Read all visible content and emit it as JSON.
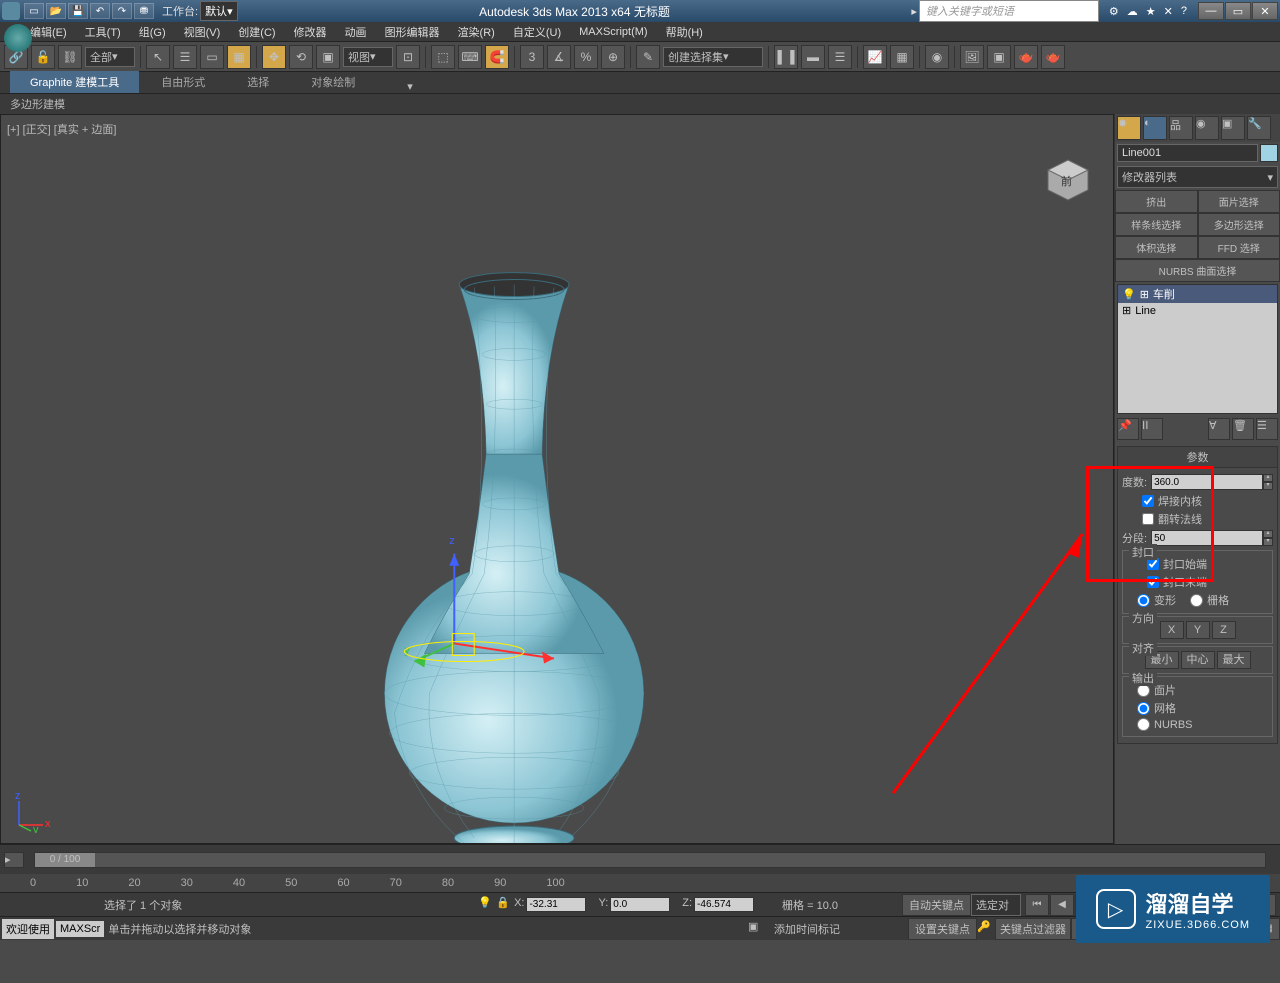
{
  "titlebar": {
    "workspace_label": "工作台: ",
    "workspace_value": "默认",
    "app_title": "Autodesk 3ds Max  2013 x64   无标题",
    "search_placeholder": "键入关键字或短语"
  },
  "menu": {
    "items": [
      "编辑(E)",
      "工具(T)",
      "组(G)",
      "视图(V)",
      "创建(C)",
      "修改器",
      "动画",
      "图形编辑器",
      "渲染(R)",
      "自定义(U)",
      "MAXScript(M)",
      "帮助(H)"
    ]
  },
  "toolbar": {
    "filter_all": "全部",
    "view_dropdown": "视图",
    "set_dropdown": "创建选择集"
  },
  "ribbon": {
    "tabs": [
      "Graphite 建模工具",
      "自由形式",
      "选择",
      "对象绘制"
    ],
    "subheader": "多边形建模"
  },
  "viewport": {
    "label": "[+] [正交] [真实 + 边面]"
  },
  "panel": {
    "object_name": "Line001",
    "modifier_list": "修改器列表",
    "mod_buttons": [
      "挤出",
      "面片选择",
      "样条线选择",
      "多边形选择",
      "体积选择",
      "FFD 选择",
      "NURBS 曲面选择"
    ],
    "stack_items": [
      "车削",
      "Line"
    ],
    "rollout_params": "参数",
    "degrees_label": "度数:",
    "degrees_value": "360.0",
    "weld_core": "焊接内核",
    "flip_normals": "翻转法线",
    "segments_label": "分段:",
    "segments_value": "50",
    "cap_label": "封口",
    "cap_start": "封口始端",
    "cap_end": "封口末端",
    "morph": "变形",
    "grid": "栅格",
    "direction": "方向",
    "dir_x": "X",
    "dir_y": "Y",
    "dir_z": "Z",
    "align": "对齐",
    "align_min": "最小",
    "align_center": "中心",
    "align_max": "最大",
    "output": "输出",
    "out_patch": "面片",
    "out_mesh": "网格",
    "out_nurbs": "NURBS"
  },
  "timeline": {
    "slider_text": "0 / 100",
    "marks": [
      "0",
      "10",
      "20",
      "30",
      "40",
      "50",
      "60",
      "70",
      "80",
      "90",
      "100"
    ]
  },
  "status": {
    "selection": "选择了 1 个对象",
    "welcome": "欢迎使用",
    "maxscript": "MAXScr",
    "prompt": "单击并拖动以选择并移动对象",
    "x_label": "X:",
    "x_val": "-32.31",
    "y_label": "Y:",
    "y_val": "0.0",
    "z_label": "Z:",
    "z_val": "-46.574",
    "grid": "栅格 = 10.0",
    "add_marker": "添加时间标记",
    "auto_key": "自动关键点",
    "set_key": "设置关键点",
    "selected": "选定对",
    "key_filter": "关键点过滤器"
  },
  "watermark": {
    "text": "溜溜自学",
    "url": "ZIXUE.3D66.COM"
  }
}
